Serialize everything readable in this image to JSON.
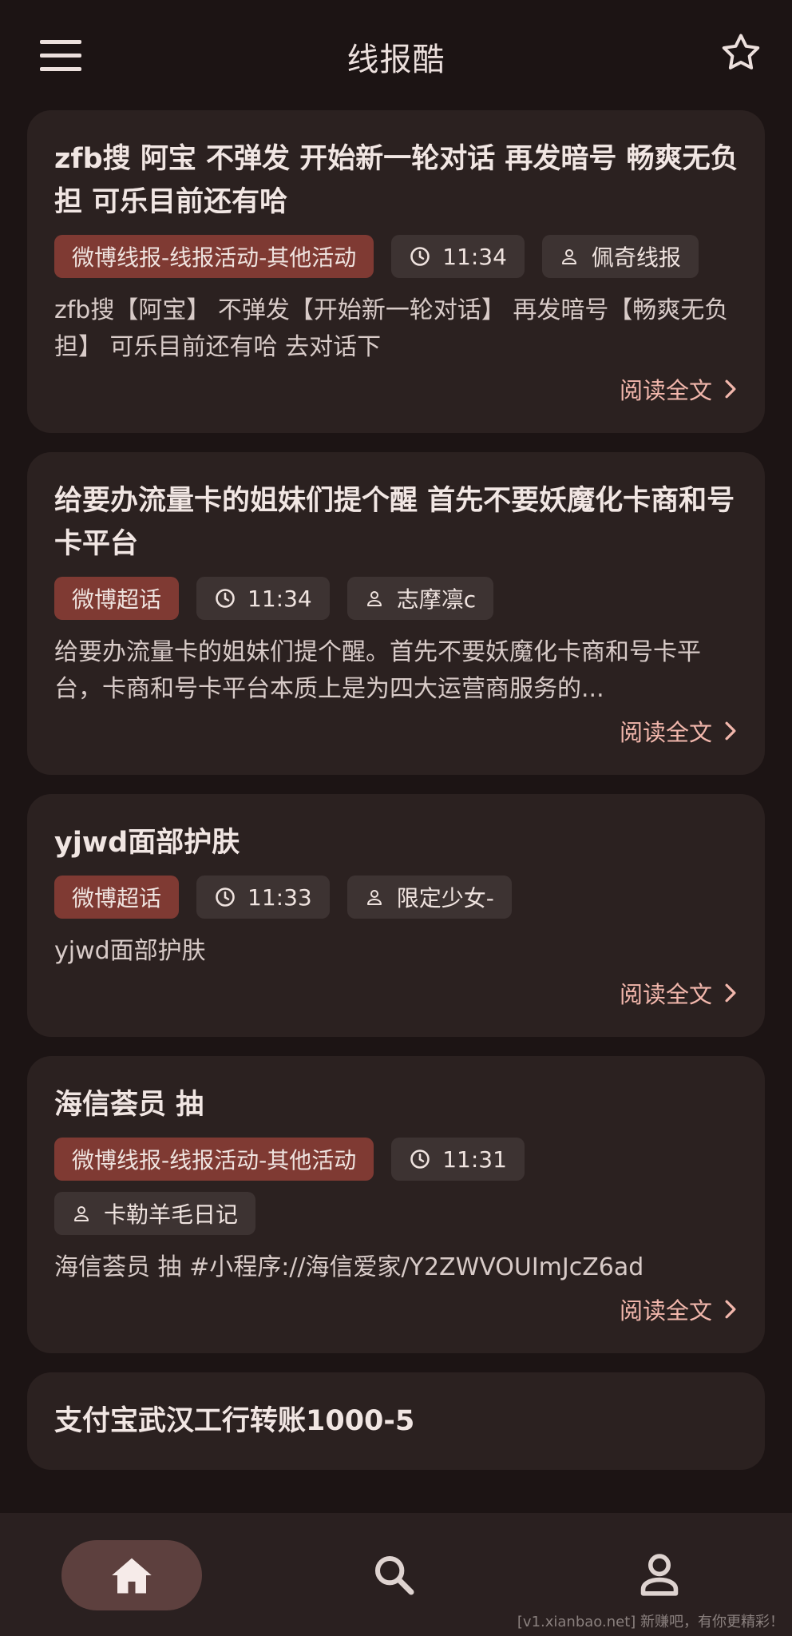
{
  "header": {
    "menu_icon": "hamburger-menu-icon",
    "title": "线报酷",
    "star_icon": "star-outline-icon"
  },
  "posts": [
    {
      "title": "zfb搜 阿宝 不弹发 开始新一轮对话 再发暗号 畅爽无负担 可乐目前还有哈",
      "category": "微博线报-线报活动-其他活动",
      "time": "11:34",
      "author": "佩奇线报",
      "summary": "zfb搜【阿宝】 不弹发【开始新一轮对话】 再发暗号【畅爽无负担】 可乐目前还有哈 去对话下",
      "read_more": "阅读全文"
    },
    {
      "title": "给要办流量卡的姐妹们提个醒 首先不要妖魔化卡商和号卡平台",
      "category": "微博超话",
      "time": "11:34",
      "author": "志摩凛c",
      "summary": "给要办流量卡的姐妹们提个醒。首先不要妖魔化卡商和号卡平台，卡商和号卡平台本质上是为四大运营商服务的...",
      "read_more": "阅读全文"
    },
    {
      "title": "yjwd面部护肤",
      "category": "微博超话",
      "time": "11:33",
      "author": "限定少女-",
      "summary": "yjwd面部护肤",
      "read_more": "阅读全文"
    },
    {
      "title": "海信荟员 抽",
      "category": "微博线报-线报活动-其他活动",
      "time": "11:31",
      "author": "卡勒羊毛日记",
      "summary": "海信荟员 抽 #小程序://海信爱家/Y2ZWVOUImJcZ6ad",
      "read_more": "阅读全文"
    },
    {
      "title": "支付宝武汉工行转账1000-5"
    }
  ],
  "bottom_nav": {
    "items": [
      "home-icon",
      "search-icon",
      "profile-icon"
    ],
    "active": "home"
  },
  "watermark": "[v1.xianbao.net] 新赚吧，有你更精彩！",
  "colors": {
    "background": "#1c1414",
    "card": "#2b2120",
    "category_tag": "#7f3a33",
    "meta_tag": "#3d3332",
    "accent_link": "#f2b7ac",
    "active_nav_pill": "#5d403e"
  }
}
